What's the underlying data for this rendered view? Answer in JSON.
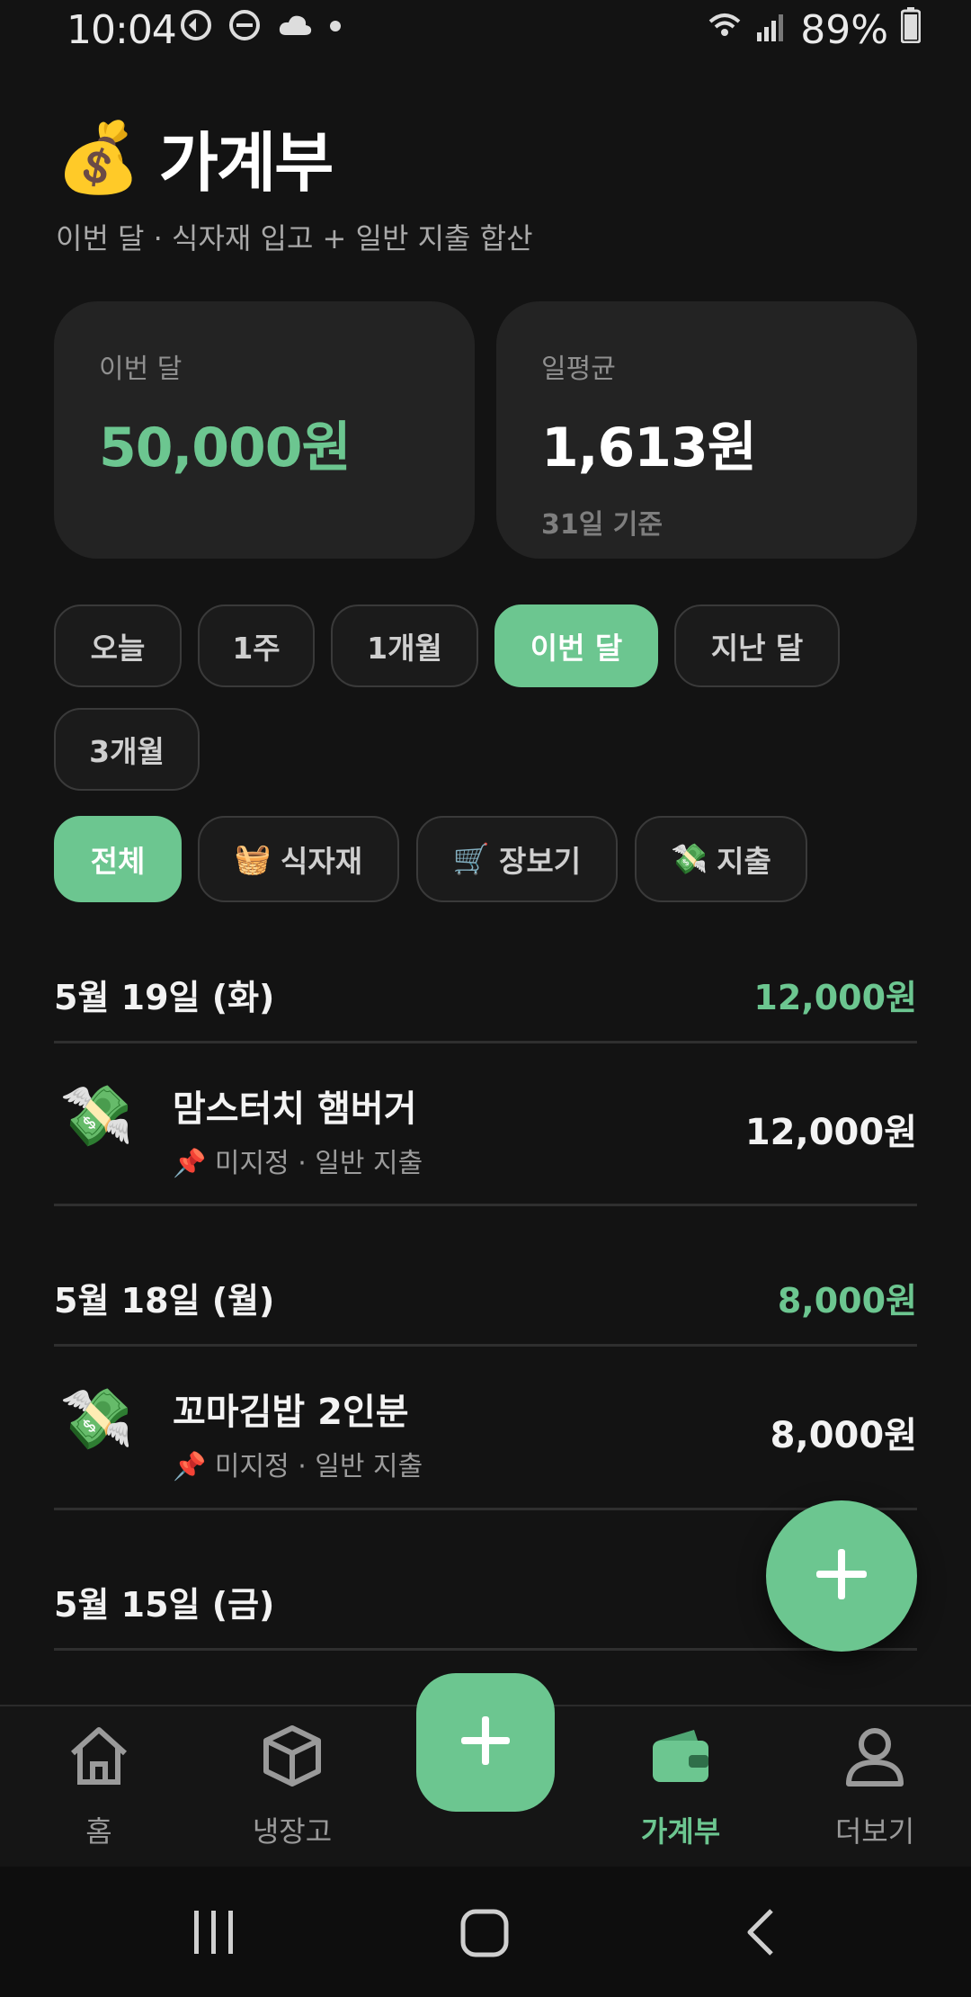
{
  "status": {
    "time": "10:04",
    "battery": "89%"
  },
  "header": {
    "icon": "💰",
    "title": "가계부",
    "subtitle": "이번 달 · 식자재 입고 + 일반 지출 합산"
  },
  "summary": {
    "month_label": "이번 달",
    "month_value": "50,000원",
    "avg_label": "일평균",
    "avg_value": "1,613원",
    "avg_note": "31일 기준"
  },
  "period_filters": [
    "오늘",
    "1주",
    "1개월",
    "이번 달",
    "지난 달",
    "3개월"
  ],
  "category_filters": [
    {
      "icon": "🧺",
      "label": "식자재"
    },
    {
      "icon": "🛒",
      "label": "장보기"
    },
    {
      "icon": "💸",
      "label": "지출"
    }
  ],
  "category_all": "전체",
  "days": [
    {
      "date": "5월 19일 (화)",
      "total": "12,000원",
      "items": [
        {
          "icon": "💸",
          "title": "맘스터치 햄버거",
          "sub": "📌 미지정 · 일반 지출",
          "amount": "12,000원"
        }
      ]
    },
    {
      "date": "5월 18일 (월)",
      "total": "8,000원",
      "items": [
        {
          "icon": "💸",
          "title": "꼬마김밥 2인분",
          "sub": "📌 미지정 · 일반 지출",
          "amount": "8,000원"
        }
      ]
    },
    {
      "date": "5월 15일 (금)",
      "total": "",
      "items": []
    }
  ],
  "nav": {
    "home": "홈",
    "fridge": "냉장고",
    "ledger": "가계부",
    "more": "더보기"
  },
  "colors": {
    "accent": "#6cc690",
    "background": "#131313",
    "card": "#232323"
  }
}
